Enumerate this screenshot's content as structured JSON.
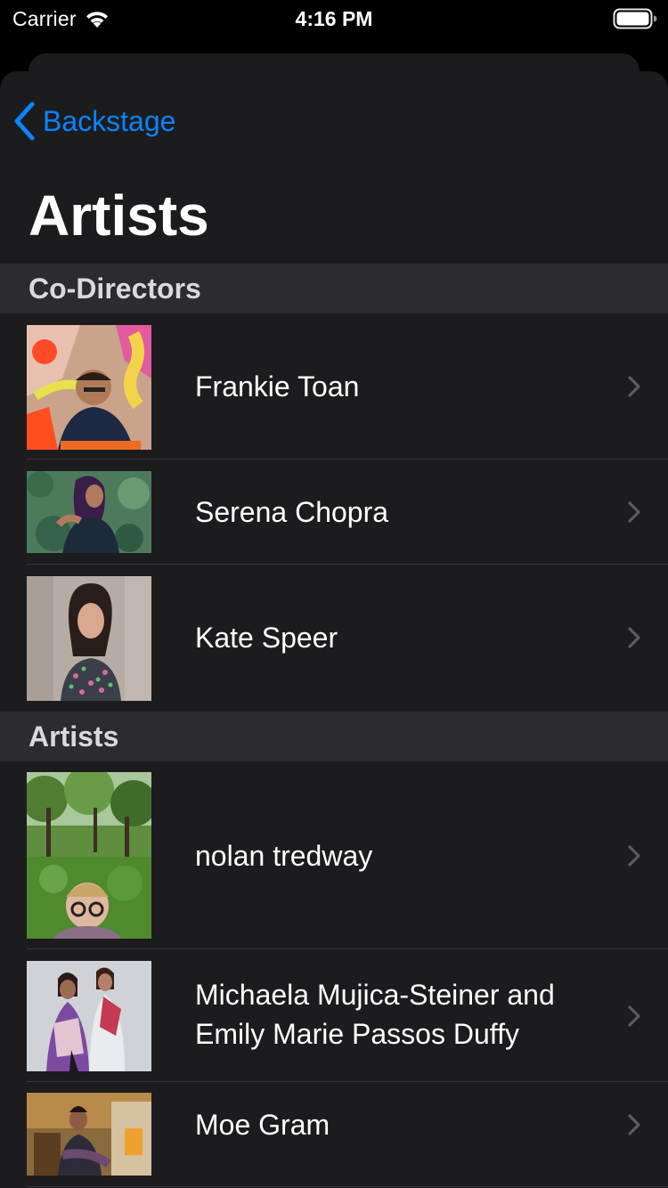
{
  "status_bar": {
    "carrier": "Carrier",
    "time": "4:16 PM",
    "wifi_icon": "wifi-icon",
    "battery_icon": "battery-full-icon"
  },
  "nav": {
    "back_label": "Backstage",
    "back_icon": "chevron-left-icon",
    "title": "Artists"
  },
  "sections": [
    {
      "header": "Co-Directors",
      "rows": [
        {
          "name": "Frankie Toan",
          "photo": "artist-photo"
        },
        {
          "name": "Serena Chopra",
          "photo": "artist-photo"
        },
        {
          "name": "Kate Speer",
          "photo": "artist-photo"
        }
      ]
    },
    {
      "header": "Artists",
      "rows": [
        {
          "name": "nolan tredway",
          "photo": "artist-photo"
        },
        {
          "name": "Michaela Mujica-Steiner and Emily Marie Passos Duffy",
          "photo": "artist-photo"
        },
        {
          "name": "Moe Gram",
          "photo": "artist-photo"
        }
      ]
    }
  ],
  "colors": {
    "accent": "#0a84ff",
    "background": "#1c1c1e",
    "section_header": "#2c2c2e",
    "separator": "#38383a"
  }
}
